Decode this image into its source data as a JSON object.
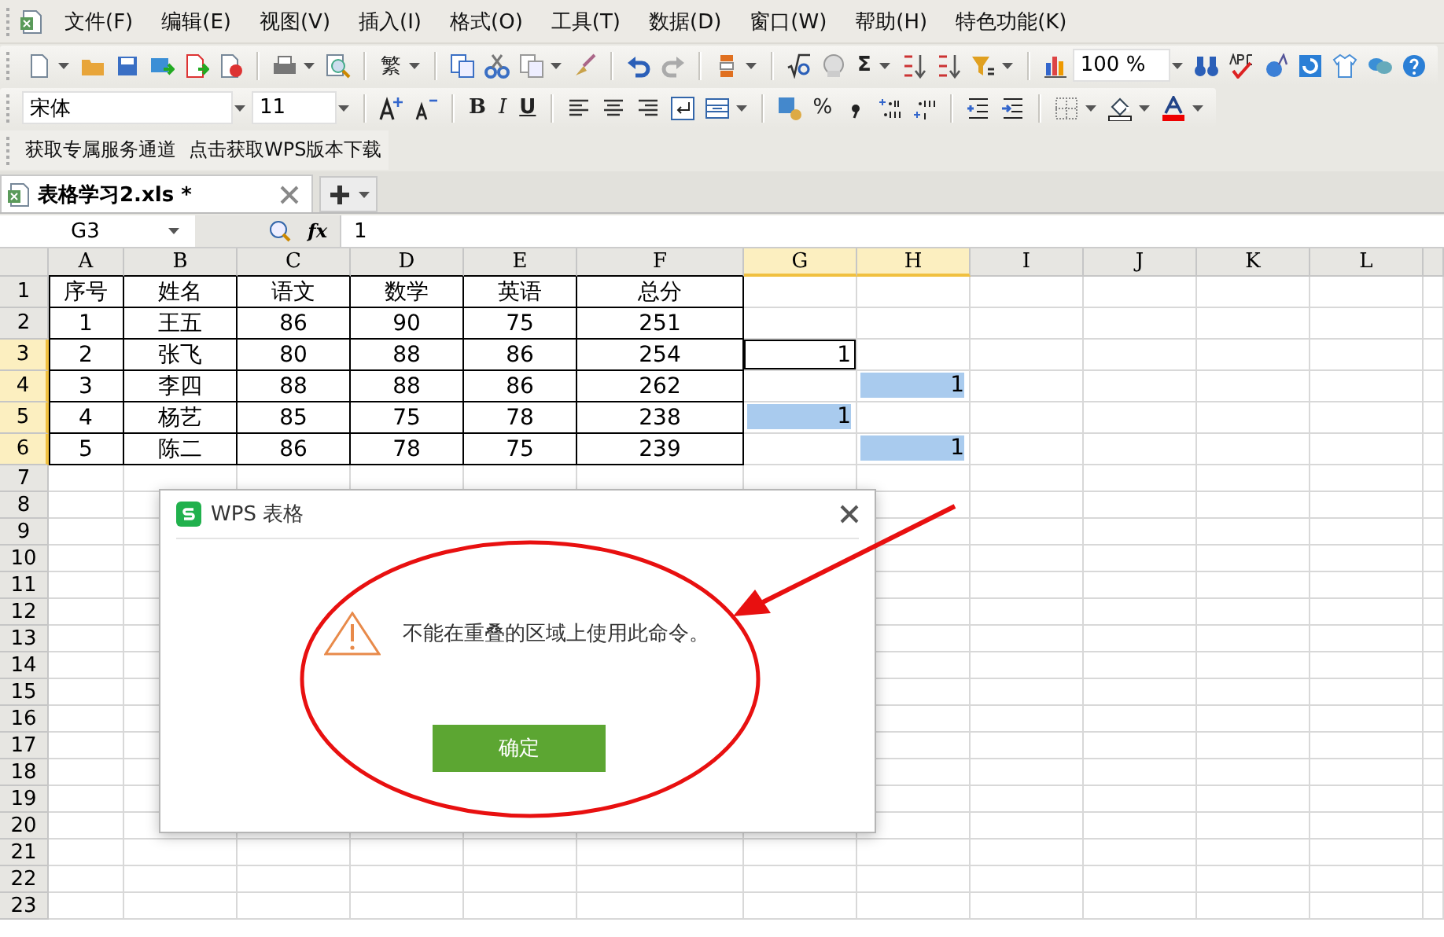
{
  "menu": [
    "文件(F)",
    "编辑(E)",
    "视图(V)",
    "插入(I)",
    "格式(O)",
    "工具(T)",
    "数据(D)",
    "窗口(W)",
    "帮助(H)",
    "特色功能(K)"
  ],
  "standard_toolbar": {
    "traditional": "繁",
    "sum": "Σ",
    "zoom": "100 %"
  },
  "format_toolbar": {
    "font": "宋体",
    "size": "11",
    "bold": "B",
    "italic": "I",
    "underline": "U",
    "percent": "%"
  },
  "links": [
    "获取专属服务通道",
    "点击获取WPS版本下载"
  ],
  "tabs": [
    {
      "label": "表格学习2.xls *",
      "selected": true
    }
  ],
  "formula_bar": {
    "cell": "G3",
    "function_label": "fx",
    "formula": "1"
  },
  "sheet": {
    "columns": [
      {
        "label": "A",
        "highlighted": false
      },
      {
        "label": "B",
        "highlighted": false
      },
      {
        "label": "C",
        "highlighted": false
      },
      {
        "label": "D",
        "highlighted": false
      },
      {
        "label": "E",
        "highlighted": false
      },
      {
        "label": "F",
        "highlighted": false
      },
      {
        "label": "G",
        "highlighted": true
      },
      {
        "label": "H",
        "highlighted": true
      },
      {
        "label": "I",
        "highlighted": false
      },
      {
        "label": "J",
        "highlighted": false
      },
      {
        "label": "K",
        "highlighted": false
      },
      {
        "label": "L",
        "highlighted": false
      }
    ],
    "rows": [
      {
        "number": "1",
        "highlighted": false,
        "cells": [
          "序号",
          "姓名",
          "语文",
          "数学",
          "英语",
          "总分"
        ]
      },
      {
        "number": "2",
        "highlighted": false,
        "cells": [
          "1",
          "王五",
          "86",
          "90",
          "75",
          "251"
        ]
      },
      {
        "number": "3",
        "highlighted": true,
        "cells": [
          "2",
          "张飞",
          "80",
          "88",
          "86",
          "254"
        ],
        "col_g": {
          "text": "1",
          "selected": true,
          "highlighted": false
        }
      },
      {
        "number": "4",
        "highlighted": true,
        "cells": [
          "3",
          "李四",
          "88",
          "88",
          "86",
          "262"
        ],
        "col_h": {
          "text": "1",
          "selected": false,
          "highlighted": true
        }
      },
      {
        "number": "5",
        "highlighted": true,
        "cells": [
          "4",
          "杨艺",
          "85",
          "75",
          "78",
          "238"
        ],
        "col_g": {
          "text": "1",
          "selected": false,
          "highlighted": true
        }
      },
      {
        "number": "6",
        "highlighted": true,
        "cells": [
          "5",
          "陈二",
          "86",
          "78",
          "75",
          "239"
        ],
        "col_h": {
          "text": "1",
          "selected": false,
          "highlighted": true
        }
      },
      {
        "number": "7",
        "highlighted": false
      },
      {
        "number": "8",
        "highlighted": false
      },
      {
        "number": "9",
        "highlighted": false
      },
      {
        "number": "10",
        "highlighted": false
      },
      {
        "number": "11",
        "highlighted": false
      },
      {
        "number": "12",
        "highlighted": false
      },
      {
        "number": "13",
        "highlighted": false
      },
      {
        "number": "14",
        "highlighted": false
      },
      {
        "number": "15",
        "highlighted": false
      },
      {
        "number": "16",
        "highlighted": false
      },
      {
        "number": "17",
        "highlighted": false
      },
      {
        "number": "18",
        "highlighted": false
      },
      {
        "number": "19",
        "highlighted": false
      },
      {
        "number": "20",
        "highlighted": false
      },
      {
        "number": "21",
        "highlighted": false
      },
      {
        "number": "22",
        "highlighted": false
      },
      {
        "number": "23",
        "highlighted": false
      }
    ]
  },
  "dialog": {
    "title": "WPS 表格",
    "message": "不能在重叠的区域上使用此命令。",
    "button": "确定"
  }
}
